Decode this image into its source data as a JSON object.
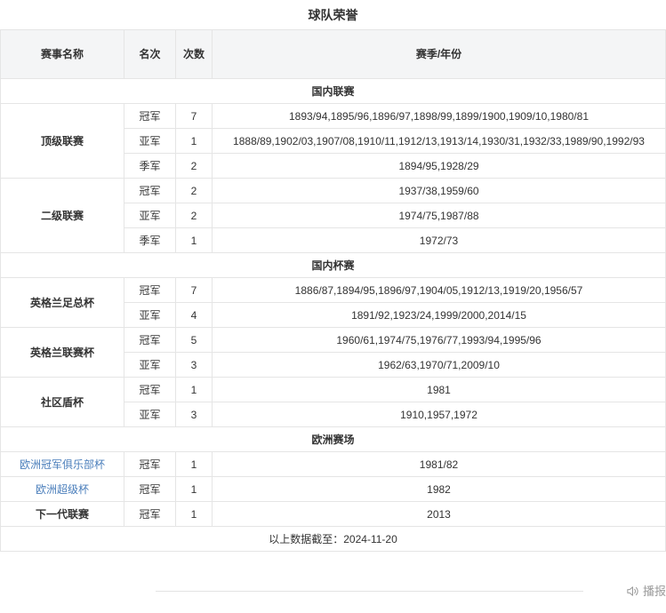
{
  "title": "球队荣誉",
  "columns": {
    "competition": "赛事名称",
    "rank": "名次",
    "count": "次数",
    "season": "赛季/年份"
  },
  "sections": [
    {
      "label": "国内联赛",
      "groups": [
        {
          "name": "顶级联赛",
          "rows": [
            {
              "rank": "冠军",
              "count": "7",
              "seasons": "1893/94,1895/96,1896/97,1898/99,1899/1900,1909/10,1980/81"
            },
            {
              "rank": "亚军",
              "count": "1",
              "seasons": "1888/89,1902/03,1907/08,1910/11,1912/13,1913/14,1930/31,1932/33,1989/90,1992/93"
            },
            {
              "rank": "季军",
              "count": "2",
              "seasons": "1894/95,1928/29"
            }
          ]
        },
        {
          "name": "二级联赛",
          "rows": [
            {
              "rank": "冠军",
              "count": "2",
              "seasons": "1937/38,1959/60"
            },
            {
              "rank": "亚军",
              "count": "2",
              "seasons": "1974/75,1987/88"
            },
            {
              "rank": "季军",
              "count": "1",
              "seasons": "1972/73"
            }
          ]
        }
      ]
    },
    {
      "label": "国内杯赛",
      "groups": [
        {
          "name": "英格兰足总杯",
          "rows": [
            {
              "rank": "冠军",
              "count": "7",
              "seasons": "1886/87,1894/95,1896/97,1904/05,1912/13,1919/20,1956/57"
            },
            {
              "rank": "亚军",
              "count": "4",
              "seasons": "1891/92,1923/24,1999/2000,2014/15"
            }
          ]
        },
        {
          "name": "英格兰联赛杯",
          "rows": [
            {
              "rank": "冠军",
              "count": "5",
              "seasons": "1960/61,1974/75,1976/77,1993/94,1995/96"
            },
            {
              "rank": "亚军",
              "count": "3",
              "seasons": "1962/63,1970/71,2009/10"
            }
          ]
        },
        {
          "name": "社区盾杯",
          "rows": [
            {
              "rank": "冠军",
              "count": "1",
              "seasons": "1981"
            },
            {
              "rank": "亚军",
              "count": "3",
              "seasons": "1910,1957,1972"
            }
          ]
        }
      ]
    },
    {
      "label": "欧洲赛场",
      "groups": [
        {
          "name": "欧洲冠军俱乐部杯",
          "is_link": true,
          "rows": [
            {
              "rank": "冠军",
              "count": "1",
              "seasons": "1981/82"
            }
          ]
        },
        {
          "name": "欧洲超级杯",
          "is_link": true,
          "rows": [
            {
              "rank": "冠军",
              "count": "1",
              "seasons": "1982"
            }
          ]
        },
        {
          "name": "下一代联赛",
          "is_link": false,
          "rows": [
            {
              "rank": "冠军",
              "count": "1",
              "seasons": "2013"
            }
          ]
        }
      ]
    }
  ],
  "footnote": "以上数据截至：2024-11-20",
  "broadcast": {
    "label": "播报",
    "icon": "speaker-icon"
  },
  "colors": {
    "link": "#4a7ebb",
    "border": "#e5e5e5",
    "header_bg": "#f4f5f6",
    "text": "#333333",
    "muted": "#9b9b9b"
  }
}
